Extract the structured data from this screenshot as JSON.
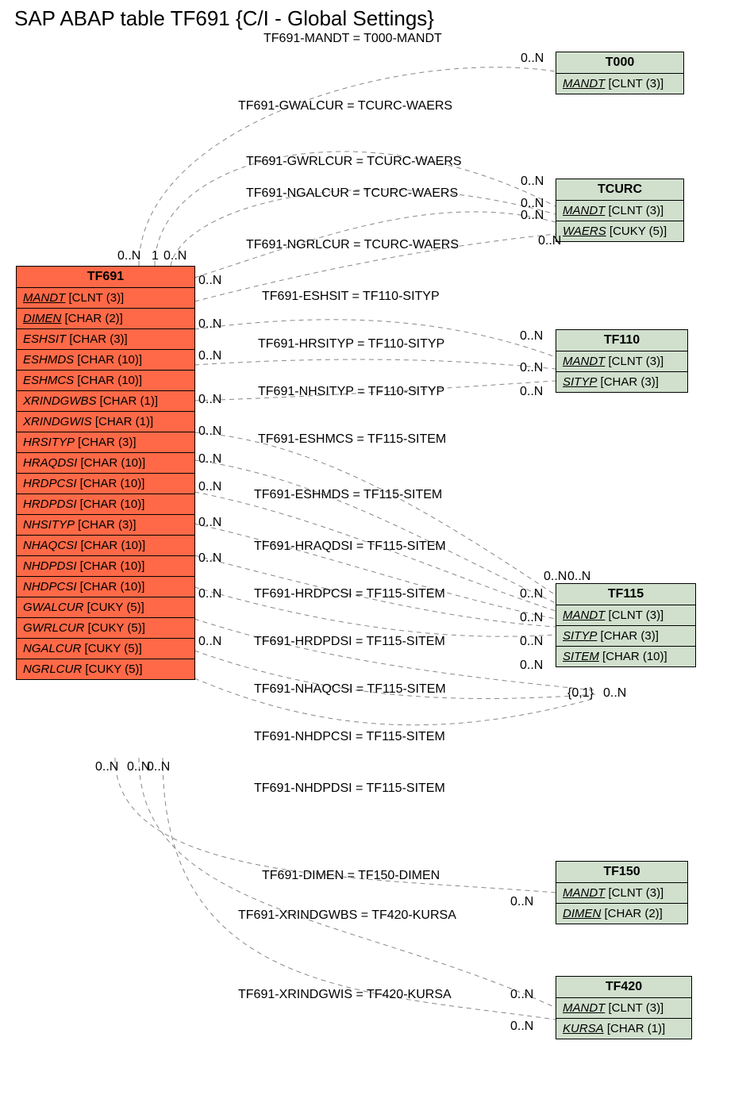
{
  "title": "SAP ABAP table TF691 {C/I - Global Settings}",
  "main_table": {
    "name": "TF691",
    "fields": [
      {
        "f": "MANDT",
        "t": "[CLNT (3)]",
        "u": true
      },
      {
        "f": "DIMEN",
        "t": "[CHAR (2)]",
        "u": true
      },
      {
        "f": "ESHSIT",
        "t": "[CHAR (3)]",
        "u": false
      },
      {
        "f": "ESHMDS",
        "t": "[CHAR (10)]",
        "u": false
      },
      {
        "f": "ESHMCS",
        "t": "[CHAR (10)]",
        "u": false
      },
      {
        "f": "XRINDGWBS",
        "t": "[CHAR (1)]",
        "u": false
      },
      {
        "f": "XRINDGWIS",
        "t": "[CHAR (1)]",
        "u": false
      },
      {
        "f": "HRSITYP",
        "t": "[CHAR (3)]",
        "u": false
      },
      {
        "f": "HRAQDSI",
        "t": "[CHAR (10)]",
        "u": false
      },
      {
        "f": "HRDPCSI",
        "t": "[CHAR (10)]",
        "u": false
      },
      {
        "f": "HRDPDSI",
        "t": "[CHAR (10)]",
        "u": false
      },
      {
        "f": "NHSITYP",
        "t": "[CHAR (3)]",
        "u": false
      },
      {
        "f": "NHAQCSI",
        "t": "[CHAR (10)]",
        "u": false
      },
      {
        "f": "NHDPDSI",
        "t": "[CHAR (10)]",
        "u": false
      },
      {
        "f": "NHDPCSI",
        "t": "[CHAR (10)]",
        "u": false
      },
      {
        "f": "GWALCUR",
        "t": "[CUKY (5)]",
        "u": false
      },
      {
        "f": "GWRLCUR",
        "t": "[CUKY (5)]",
        "u": false
      },
      {
        "f": "NGALCUR",
        "t": "[CUKY (5)]",
        "u": false
      },
      {
        "f": "NGRLCUR",
        "t": "[CUKY (5)]",
        "u": false
      }
    ]
  },
  "ref_tables": [
    {
      "name": "T000",
      "fields": [
        {
          "f": "MANDT",
          "t": "[CLNT (3)]",
          "u": true
        }
      ]
    },
    {
      "name": "TCURC",
      "fields": [
        {
          "f": "MANDT",
          "t": "[CLNT (3)]",
          "u": true
        },
        {
          "f": "WAERS",
          "t": "[CUKY (5)]",
          "u": true
        }
      ]
    },
    {
      "name": "TF110",
      "fields": [
        {
          "f": "MANDT",
          "t": "[CLNT (3)]",
          "u": true
        },
        {
          "f": "SITYP",
          "t": "[CHAR (3)]",
          "u": true
        }
      ]
    },
    {
      "name": "TF115",
      "fields": [
        {
          "f": "MANDT",
          "t": "[CLNT (3)]",
          "u": true
        },
        {
          "f": "SITYP",
          "t": "[CHAR (3)]",
          "u": true
        },
        {
          "f": "SITEM",
          "t": "[CHAR (10)]",
          "u": true
        }
      ]
    },
    {
      "name": "TF150",
      "fields": [
        {
          "f": "MANDT",
          "t": "[CLNT (3)]",
          "u": true
        },
        {
          "f": "DIMEN",
          "t": "[CHAR (2)]",
          "u": true
        }
      ]
    },
    {
      "name": "TF420",
      "fields": [
        {
          "f": "MANDT",
          "t": "[CLNT (3)]",
          "u": true
        },
        {
          "f": "KURSA",
          "t": "[CHAR (1)]",
          "u": true
        }
      ]
    }
  ],
  "relations": [
    "TF691-MANDT = T000-MANDT",
    "TF691-GWALCUR = TCURC-WAERS",
    "TF691-GWRLCUR = TCURC-WAERS",
    "TF691-NGALCUR = TCURC-WAERS",
    "TF691-NGRLCUR = TCURC-WAERS",
    "TF691-ESHSIT = TF110-SITYP",
    "TF691-HRSITYP = TF110-SITYP",
    "TF691-NHSITYP = TF110-SITYP",
    "TF691-ESHMCS = TF115-SITEM",
    "TF691-ESHMDS = TF115-SITEM",
    "TF691-HRAQDSI = TF115-SITEM",
    "TF691-HRDPCSI = TF115-SITEM",
    "TF691-HRDPDSI = TF115-SITEM",
    "TF691-NHAQCSI = TF115-SITEM",
    "TF691-NHDPCSI = TF115-SITEM",
    "TF691-NHDPDSI = TF115-SITEM",
    "TF691-DIMEN = TF150-DIMEN",
    "TF691-XRINDGWBS = TF420-KURSA",
    "TF691-XRINDGWIS = TF420-KURSA"
  ],
  "card_labels": {
    "top_left": [
      "0..N",
      "1",
      "0..N"
    ],
    "bot_left": [
      "0..N",
      "0..N",
      "0..N"
    ],
    "right_col_src": [
      "0..N",
      "0..N",
      "0..N",
      "0..N",
      "0..N",
      "0..N",
      "0..N",
      "0..N",
      "0..N",
      "0..N",
      "0..N"
    ],
    "right_dst": [
      "0..N",
      "0..N",
      "0..N",
      "0..N",
      "0..N",
      "0..N",
      "0..N",
      "0..N",
      "0..N",
      "0..N",
      "0..N",
      "0..N",
      "0..N",
      "0..N",
      "{0,1}",
      "0..N",
      "0..N",
      "0..N",
      "0..N"
    ]
  },
  "chart_data": {
    "type": "diagram",
    "entity": "TF691",
    "description": "C/I - Global Settings",
    "relationships": [
      {
        "from": "TF691.MANDT",
        "to": "T000.MANDT",
        "card_from": "0..N",
        "card_to": "1"
      },
      {
        "from": "TF691.GWALCUR",
        "to": "TCURC.WAERS",
        "card_from": "0..N",
        "card_to": "0..N"
      },
      {
        "from": "TF691.GWRLCUR",
        "to": "TCURC.WAERS",
        "card_from": "0..N",
        "card_to": "0..N"
      },
      {
        "from": "TF691.NGALCUR",
        "to": "TCURC.WAERS",
        "card_from": "0..N",
        "card_to": "0..N"
      },
      {
        "from": "TF691.NGRLCUR",
        "to": "TCURC.WAERS",
        "card_from": "0..N",
        "card_to": "0..N"
      },
      {
        "from": "TF691.ESHSIT",
        "to": "TF110.SITYP",
        "card_from": "0..N",
        "card_to": "0..N"
      },
      {
        "from": "TF691.HRSITYP",
        "to": "TF110.SITYP",
        "card_from": "0..N",
        "card_to": "0..N"
      },
      {
        "from": "TF691.NHSITYP",
        "to": "TF110.SITYP",
        "card_from": "0..N",
        "card_to": "0..N"
      },
      {
        "from": "TF691.ESHMCS",
        "to": "TF115.SITEM",
        "card_from": "0..N",
        "card_to": "0..N"
      },
      {
        "from": "TF691.ESHMDS",
        "to": "TF115.SITEM",
        "card_from": "0..N",
        "card_to": "0..N"
      },
      {
        "from": "TF691.HRAQDSI",
        "to": "TF115.SITEM",
        "card_from": "0..N",
        "card_to": "0..N"
      },
      {
        "from": "TF691.HRDPCSI",
        "to": "TF115.SITEM",
        "card_from": "0..N",
        "card_to": "0..N"
      },
      {
        "from": "TF691.HRDPDSI",
        "to": "TF115.SITEM",
        "card_from": "0..N",
        "card_to": "0..N"
      },
      {
        "from": "TF691.NHAQCSI",
        "to": "TF115.SITEM",
        "card_from": "0..N",
        "card_to": "0..N"
      },
      {
        "from": "TF691.NHDPCSI",
        "to": "TF115.SITEM",
        "card_from": "0..N",
        "card_to": "0..N"
      },
      {
        "from": "TF691.NHDPDSI",
        "to": "TF115.SITEM",
        "card_from": "0..N",
        "card_to": "0..N"
      },
      {
        "from": "TF691.DIMEN",
        "to": "TF150.DIMEN",
        "card_from": "0..N",
        "card_to": "{0,1}"
      },
      {
        "from": "TF691.XRINDGWBS",
        "to": "TF420.KURSA",
        "card_from": "0..N",
        "card_to": "0..N"
      },
      {
        "from": "TF691.XRINDGWIS",
        "to": "TF420.KURSA",
        "card_from": "0..N",
        "card_to": "0..N"
      }
    ]
  }
}
